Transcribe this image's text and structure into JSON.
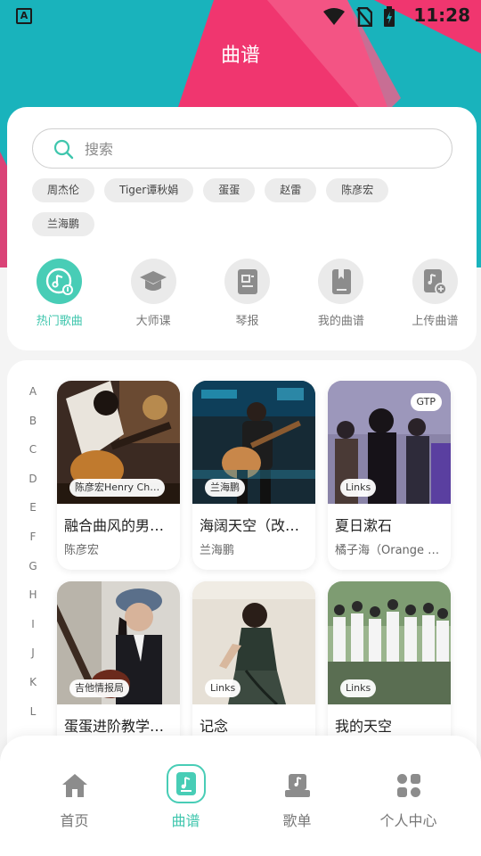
{
  "status": {
    "time": "11:28",
    "app_badge": "A"
  },
  "header": {
    "title": "曲谱"
  },
  "search": {
    "placeholder": "搜索",
    "value": ""
  },
  "tags": [
    "周杰伦",
    "Tiger谭秋娟",
    "蛋蛋",
    "赵雷",
    "陈彦宏",
    "兰海鹏"
  ],
  "categories": [
    {
      "label": "热门歌曲",
      "icon": "music-disc-icon",
      "active": true
    },
    {
      "label": "大师课",
      "icon": "graduation-cap-icon",
      "active": false
    },
    {
      "label": "琴报",
      "icon": "newspaper-icon",
      "active": false
    },
    {
      "label": "我的曲谱",
      "icon": "book-icon",
      "active": false
    },
    {
      "label": "上传曲谱",
      "icon": "upload-sheet-icon",
      "active": false
    }
  ],
  "alphabet": [
    "A",
    "B",
    "C",
    "D",
    "E",
    "F",
    "G",
    "H",
    "I",
    "J",
    "K",
    "L"
  ],
  "songs": [
    {
      "title": "融合曲风的男…",
      "subtitle": "陈彦宏",
      "chip": "陈彦宏Henry Ch…",
      "badge": ""
    },
    {
      "title": "海阔天空（改…",
      "subtitle": "兰海鹏",
      "chip": "兰海鹏",
      "badge": ""
    },
    {
      "title": "夏日漱石",
      "subtitle": "橘子海（Orange O…",
      "chip": "Links",
      "badge": "GTP"
    },
    {
      "title": "蛋蛋进阶教学…",
      "subtitle": "",
      "chip": "吉他情报局",
      "badge": ""
    },
    {
      "title": "记念",
      "subtitle": "",
      "chip": "Links",
      "badge": ""
    },
    {
      "title": "我的天空",
      "subtitle": "",
      "chip": "Links",
      "badge": ""
    }
  ],
  "nav": [
    {
      "label": "首页",
      "icon": "home-icon",
      "active": false
    },
    {
      "label": "曲谱",
      "icon": "sheet-music-icon",
      "active": true
    },
    {
      "label": "歌单",
      "icon": "playlist-icon",
      "active": false
    },
    {
      "label": "个人中心",
      "icon": "profile-grid-icon",
      "active": false
    }
  ],
  "colors": {
    "accent": "#48cdb6",
    "teal_bg": "#19b3bc",
    "pink": "#f0366f"
  }
}
